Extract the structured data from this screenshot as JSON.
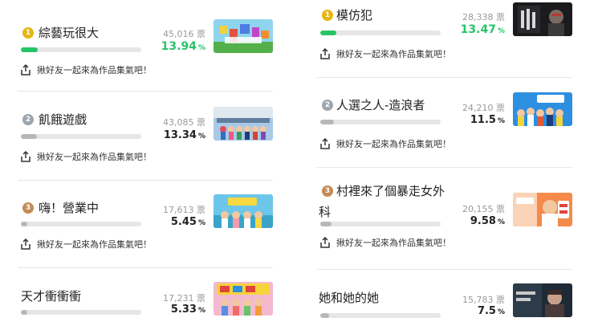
{
  "share_label": "揪好友一起來為作品集氣吧！",
  "colors": {
    "accent": "#27c467",
    "bar_track": "#e6e6e6",
    "bar_fill": "#b8b8b8"
  },
  "left_column": [
    {
      "rank_badge": "1",
      "title": "綜藝玩很大",
      "votes": "45,016",
      "unit": "票",
      "percent": "13.94",
      "share": "揪好友一起來為作品集氣吧！",
      "bar_fraction": 0.139
    },
    {
      "rank_badge": "2",
      "title": "飢餓遊戲",
      "votes": "43,085",
      "unit": "票",
      "percent": "13.34",
      "share": "揪好友一起來為作品集氣吧！",
      "bar_fraction": 0.133
    },
    {
      "rank_badge": "3",
      "title": "嗨！營業中",
      "votes": "17,613",
      "unit": "票",
      "percent": "5.45",
      "share": "揪好友一起來為作品集氣吧！",
      "bar_fraction": 0.055
    },
    {
      "rank_badge": "",
      "title": "天才衝衝衝",
      "votes": "17,231",
      "unit": "票",
      "percent": "5.33",
      "bar_fraction": 0.053
    }
  ],
  "right_column": [
    {
      "rank_badge": "1",
      "title": "模仿犯",
      "votes": "28,338",
      "unit": "票",
      "percent": "13.47",
      "share": "揪好友一起來為作品集氣吧！",
      "bar_fraction": 0.135
    },
    {
      "rank_badge": "2",
      "title": "人選之人-造浪者",
      "votes": "24,210",
      "unit": "票",
      "percent": "11.5",
      "share": "揪好友一起來為作品集氣吧！",
      "bar_fraction": 0.115
    },
    {
      "rank_badge": "3",
      "title": "村裡來了個暴走女外科",
      "votes": "20,155",
      "unit": "票",
      "percent": "9.58",
      "share": "揪好友一起來為作品集氣吧！",
      "bar_fraction": 0.096
    },
    {
      "rank_badge": "",
      "title": "她和她的她",
      "votes": "15,783",
      "unit": "票",
      "percent": "7.5",
      "bar_fraction": 0.075
    }
  ]
}
